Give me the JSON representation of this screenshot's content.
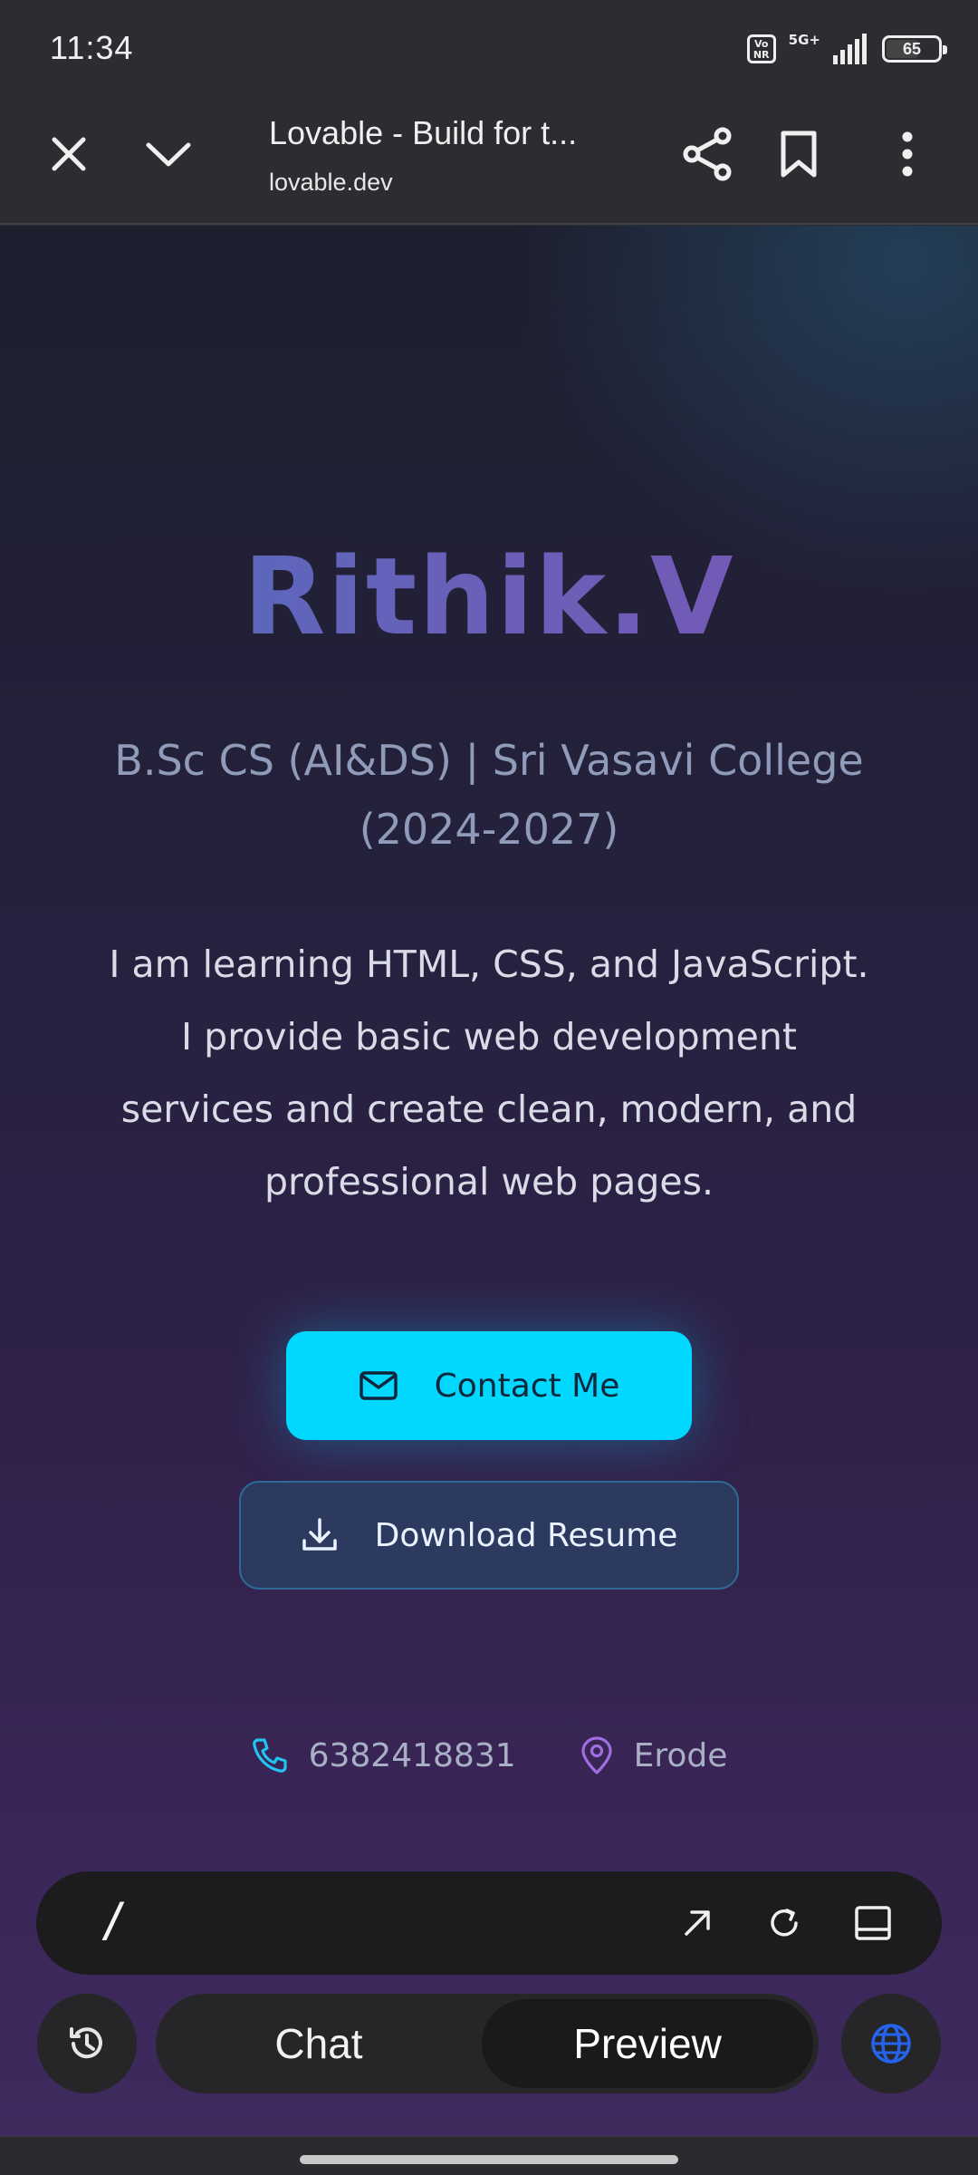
{
  "status_bar": {
    "time": "11:34",
    "volte_label": "Vo NR",
    "network_label": "5G+",
    "battery_level": 65,
    "battery_text": "65"
  },
  "browser": {
    "page_title": "Lovable - Build for t...",
    "url": "lovable.dev",
    "icons": [
      "close-icon",
      "chevron-down-icon",
      "share-icon",
      "bookmark-icon",
      "more-vertical-icon"
    ]
  },
  "hero": {
    "name": "Rithik.V",
    "degree": "B.Sc CS (AI&DS) | Sri Vasavi College (2024-2027)",
    "description": "I am learning HTML, CSS, and JavaScript. I provide basic web development services and create clean, modern, and professional web pages.",
    "contact_button": "Contact Me",
    "resume_button": "Download Resume",
    "phone": "6382418831",
    "location": "Erode"
  },
  "command_bar": {
    "input_text": "/",
    "icons": [
      "open-external-icon",
      "refresh-icon",
      "panel-icon"
    ]
  },
  "bottom_tabs": {
    "chat_label": "Chat",
    "preview_label": "Preview",
    "active": "Preview"
  },
  "colors": {
    "accent": "#00d8ff",
    "name_gradient_start": "#4f6fbf",
    "name_gradient_end": "#7a56b4",
    "phone_icon": "#22c3f0",
    "location_icon": "#a06ee0",
    "globe_icon": "#2563eb"
  }
}
